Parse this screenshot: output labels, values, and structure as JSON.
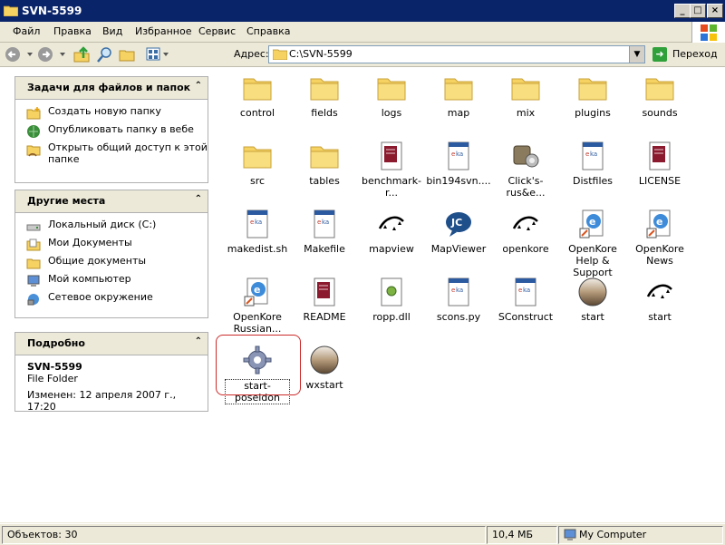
{
  "window": {
    "title": "SVN-5599"
  },
  "menu": [
    "Файл",
    "Правка",
    "Вид",
    "Избранное",
    "Сервис",
    "Справка"
  ],
  "toolbar": {
    "address_label": "Адрес:",
    "address_value": "C:\\SVN-5599",
    "go_label": "Переход"
  },
  "tasks_panel": {
    "title": "Задачи для файлов и папок",
    "items": [
      {
        "label": "Создать новую папку",
        "icon": "new-folder-icon"
      },
      {
        "label": "Опубликовать папку в вебе",
        "icon": "web-publish-icon"
      },
      {
        "label": "Открыть общий доступ к этой папке",
        "icon": "share-folder-icon"
      }
    ]
  },
  "places_panel": {
    "title": "Другие места",
    "items": [
      {
        "label": "Локальный диск (C:)",
        "icon": "drive-icon"
      },
      {
        "label": "Мои Документы",
        "icon": "my-documents-icon"
      },
      {
        "label": "Общие документы",
        "icon": "shared-documents-icon"
      },
      {
        "label": "Мой компьютер",
        "icon": "my-computer-icon"
      },
      {
        "label": "Сетевое окружение",
        "icon": "network-icon"
      }
    ]
  },
  "details_panel": {
    "title": "Подробно",
    "name": "SVN-5599",
    "type": "File Folder",
    "modified": "Изменен: 12 апреля 2007 г., 17:20"
  },
  "files": [
    {
      "name": "control",
      "icon": "folder"
    },
    {
      "name": "fields",
      "icon": "folder"
    },
    {
      "name": "logs",
      "icon": "folder"
    },
    {
      "name": "map",
      "icon": "folder"
    },
    {
      "name": "mix",
      "icon": "folder"
    },
    {
      "name": "plugins",
      "icon": "folder"
    },
    {
      "name": "sounds",
      "icon": "folder"
    },
    {
      "name": "src",
      "icon": "folder"
    },
    {
      "name": "tables",
      "icon": "folder"
    },
    {
      "name": "benchmark-r...",
      "icon": "book"
    },
    {
      "name": "bin194svn....",
      "icon": "doc"
    },
    {
      "name": "Click's-rus&e...",
      "icon": "gear-box"
    },
    {
      "name": "Distfiles",
      "icon": "doc"
    },
    {
      "name": "LICENSE",
      "icon": "book"
    },
    {
      "name": "makedist.sh",
      "icon": "doc"
    },
    {
      "name": "Makefile",
      "icon": "doc"
    },
    {
      "name": "mapview",
      "icon": "sparkle"
    },
    {
      "name": "MapViewer",
      "icon": "bubble"
    },
    {
      "name": "openkore",
      "icon": "sparkle"
    },
    {
      "name": "OpenKore Help & Support",
      "icon": "ie"
    },
    {
      "name": "OpenKore News",
      "icon": "ie"
    },
    {
      "name": "OpenKore Russian...",
      "icon": "ie"
    },
    {
      "name": "README",
      "icon": "book"
    },
    {
      "name": "ropp.dll",
      "icon": "dll"
    },
    {
      "name": "scons.py",
      "icon": "doc"
    },
    {
      "name": "SConstruct",
      "icon": "doc"
    },
    {
      "name": "start",
      "icon": "orb"
    },
    {
      "name": "start",
      "icon": "sparkle"
    },
    {
      "name": "start-poseidon",
      "icon": "gear"
    },
    {
      "name": "wxstart",
      "icon": "orb"
    }
  ],
  "status": {
    "objects": "Объектов: 30",
    "size": "10,4 МБ",
    "location": "My Computer"
  },
  "colors": {
    "title_bar": "#0A246A",
    "chrome": "#ECE9D8",
    "folder": "#F5D262",
    "selection_outline": "#CC2A2A"
  }
}
